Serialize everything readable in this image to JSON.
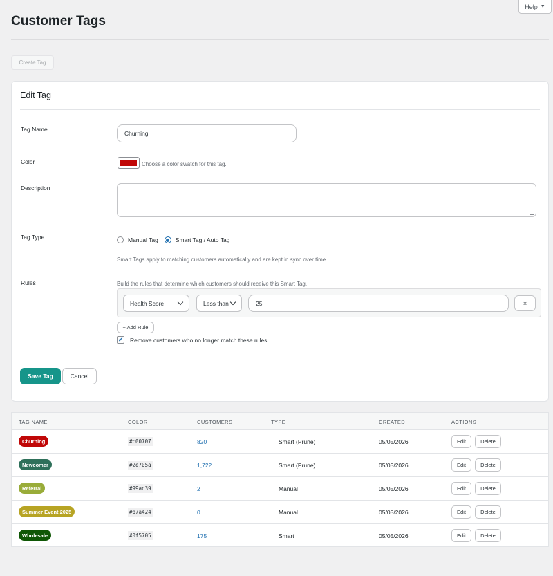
{
  "header": {
    "title": "Customer Tags",
    "help_label": "Help",
    "create_label": "Create Tag"
  },
  "form": {
    "title": "Edit Tag",
    "name_label": "Tag Name",
    "name_value": "Churning",
    "color_label": "Color",
    "color_value": "#c00707",
    "color_hint": "Choose a color swatch for this tag.",
    "description_label": "Description",
    "description_value": "",
    "type_label": "Tag Type",
    "type_options": [
      {
        "label": "Manual Tag",
        "selected": false
      },
      {
        "label": "Smart Tag / Auto Tag",
        "selected": true
      }
    ],
    "type_hint": "Smart Tags apply to matching customers automatically and are kept in sync over time.",
    "rules_label": "Rules",
    "rules_hint": "Build the rules that determine which customers should receive this Smart Tag.",
    "rule": {
      "field": "Health Score",
      "operator": "Less than",
      "value": "25",
      "remove_label": "×"
    },
    "add_rule_label": "+ Add Rule",
    "prune_label": "Remove customers who no longer match these rules",
    "prune_checked": true,
    "save_label": "Save Tag",
    "cancel_label": "Cancel"
  },
  "table": {
    "headers": {
      "name": "TAG NAME",
      "color": "COLOR",
      "customers": "CUSTOMERS",
      "type": "TYPE",
      "created": "CREATED",
      "actions": "ACTIONS"
    },
    "edit_label": "Edit",
    "delete_label": "Delete",
    "rows": [
      {
        "name": "Churning",
        "color": "#c00707",
        "customers": "820",
        "type": "Smart (Prune)",
        "created": "05/05/2026"
      },
      {
        "name": "Newcomer",
        "color": "#2e705a",
        "customers": "1,722",
        "type": "Smart (Prune)",
        "created": "05/05/2026"
      },
      {
        "name": "Referral",
        "color": "#99ac39",
        "customers": "2",
        "type": "Manual",
        "created": "05/05/2026"
      },
      {
        "name": "Summer Event 2025",
        "color": "#b7a424",
        "customers": "0",
        "type": "Manual",
        "created": "05/05/2026"
      },
      {
        "name": "Wholesale",
        "color": "#0f5705",
        "customers": "175",
        "type": "Smart",
        "created": "05/05/2026"
      }
    ]
  }
}
